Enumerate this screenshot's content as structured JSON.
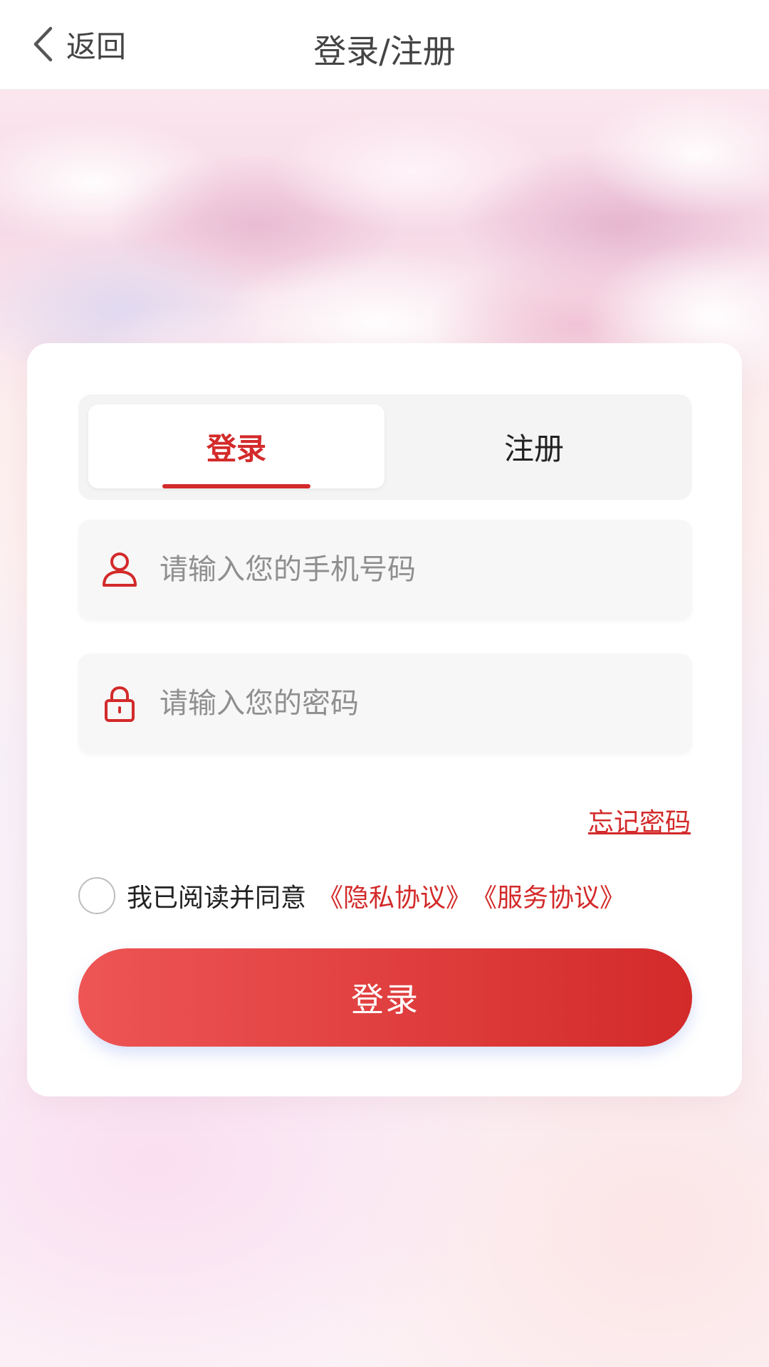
{
  "header": {
    "back_label": "返回",
    "title": "登录/注册"
  },
  "tabs": [
    {
      "label": "登录",
      "active": true
    },
    {
      "label": "注册",
      "active": false
    }
  ],
  "form": {
    "phone_placeholder": "请输入您的手机号码",
    "phone_value": "",
    "password_placeholder": "请输入您的密码",
    "password_value": "",
    "forgot_label": "忘记密码",
    "agree_text": "我已阅读并同意",
    "privacy_link": "《隐私协议》",
    "service_link": "《服务协议》",
    "agree_checked": false,
    "submit_label": "登录"
  },
  "icons": {
    "back": "chevron-left-icon",
    "user": "user-icon",
    "lock": "lock-icon"
  },
  "colors": {
    "accent": "#d32a2a",
    "button_gradient_start": "#ee5555",
    "button_gradient_end": "#d32a2a"
  }
}
